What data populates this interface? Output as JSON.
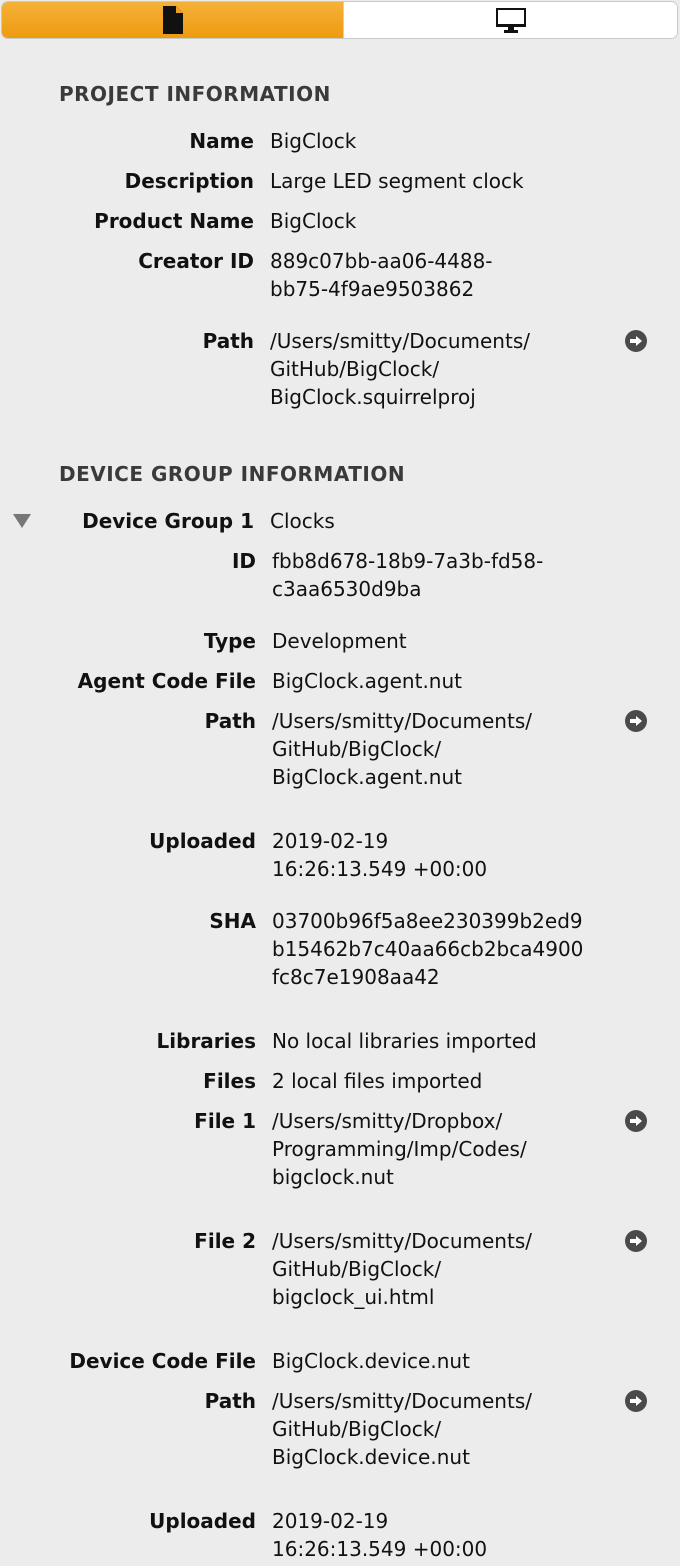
{
  "tabs": [
    {
      "icon": "document-icon",
      "active": true
    },
    {
      "icon": "monitor-icon",
      "active": false
    }
  ],
  "project": {
    "title": "PROJECT INFORMATION",
    "name_label": "Name",
    "name": "BigClock",
    "description_label": "Description",
    "description": "Large LED segment clock",
    "product_label": "Product Name",
    "product": "BigClock",
    "creator_label": "Creator ID",
    "creator_1": "889c07bb-aa06-4488-",
    "creator_2": "bb75-4f9ae9503862",
    "path_label": "Path",
    "path_1": "/Users/smitty/Documents/",
    "path_2": "GitHub/BigClock/",
    "path_3": "BigClock.squirrelproj"
  },
  "device_group": {
    "title": "DEVICE GROUP INFORMATION",
    "group_label": "Device Group 1",
    "group": "Clocks",
    "id_label": "ID",
    "id_1": "fbb8d678-18b9-7a3b-fd58-",
    "id_2": "c3aa6530d9ba",
    "type_label": "Type",
    "type": "Development",
    "agent_label": "Agent Code File",
    "agent": "BigClock.agent.nut",
    "agent_path_label": "Path",
    "agent_path_1": "/Users/smitty/Documents/",
    "agent_path_2": "GitHub/BigClock/",
    "agent_path_3": "BigClock.agent.nut",
    "uploaded_label": "Uploaded",
    "uploaded_1": "2019-02-19",
    "uploaded_2": "16:26:13.549 +00:00",
    "sha_label": "SHA",
    "sha_1": "03700b96f5a8ee230399b2ed9",
    "sha_2": "b15462b7c40aa66cb2bca4900",
    "sha_3": "fc8c7e1908aa42",
    "libraries_label": "Libraries",
    "libraries": "No local libraries imported",
    "files_label": "Files",
    "files": "2 local files imported",
    "file1_label": "File 1",
    "file1_1": "/Users/smitty/Dropbox/",
    "file1_2": "Programming/Imp/Codes/",
    "file1_3": "bigclock.nut",
    "file2_label": "File 2",
    "file2_1": "/Users/smitty/Documents/",
    "file2_2": "GitHub/BigClock/",
    "file2_3": "bigclock_ui.html",
    "device_label": "Device Code File",
    "device": "BigClock.device.nut",
    "device_path_label": "Path",
    "device_path_1": "/Users/smitty/Documents/",
    "device_path_2": "GitHub/BigClock/",
    "device_path_3": "BigClock.device.nut",
    "device_uploaded_label": "Uploaded",
    "device_uploaded_1": "2019-02-19",
    "device_uploaded_2": "16:26:13.549 +00:00"
  }
}
